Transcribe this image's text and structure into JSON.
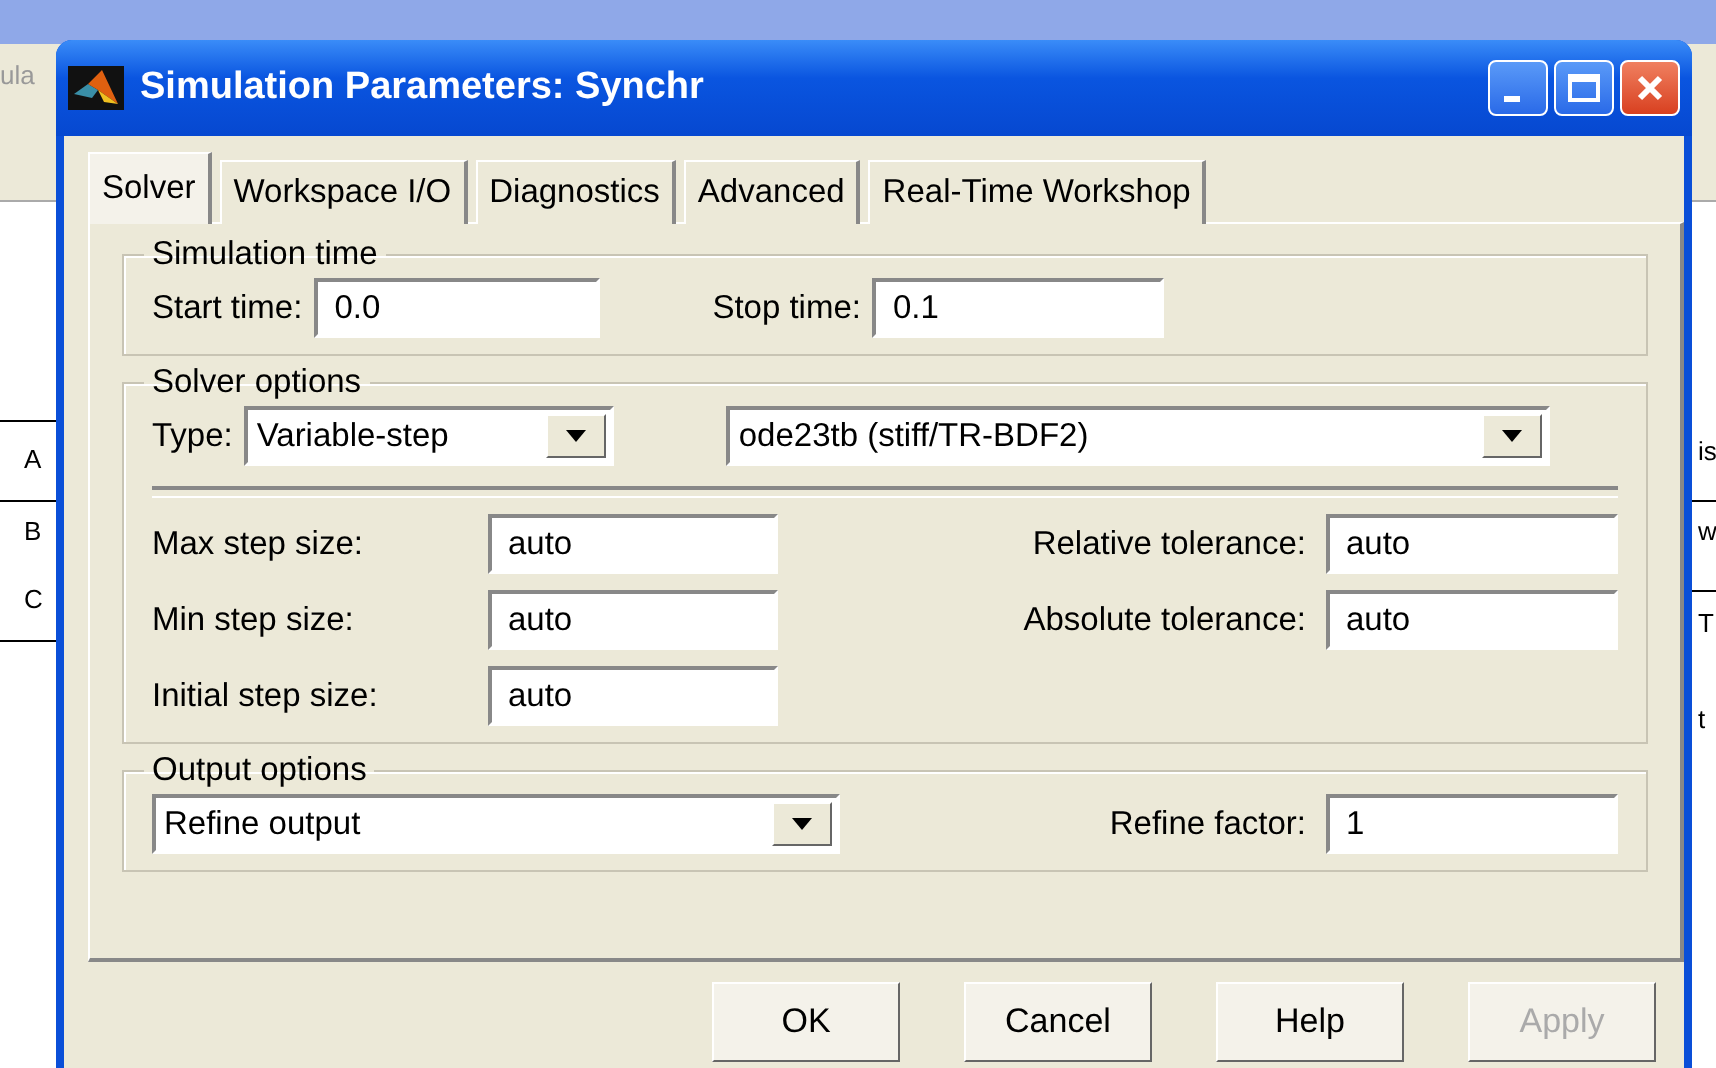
{
  "background_window": {
    "left_fragments": [
      "ula",
      "A",
      "B",
      "C"
    ],
    "right_fragments": [
      "is",
      "w",
      "T",
      "t"
    ]
  },
  "window": {
    "title": "Simulation Parameters: Synchr"
  },
  "tabs": [
    {
      "label": "Solver",
      "selected": true
    },
    {
      "label": "Workspace I/O",
      "selected": false
    },
    {
      "label": "Diagnostics",
      "selected": false
    },
    {
      "label": "Advanced",
      "selected": false
    },
    {
      "label": "Real-Time Workshop",
      "selected": false
    }
  ],
  "simulation_time": {
    "title": "Simulation time",
    "start_label": "Start time:",
    "start_value": "0.0",
    "stop_label": "Stop time:",
    "stop_value": "0.1"
  },
  "solver_options": {
    "title": "Solver options",
    "type_label": "Type:",
    "type_value": "Variable-step",
    "solver_value": "ode23tb (stiff/TR-BDF2)",
    "left_fields": [
      {
        "label": "Max step size:",
        "value": "auto"
      },
      {
        "label": "Min step size:",
        "value": "auto"
      },
      {
        "label": "Initial step size:",
        "value": "auto"
      }
    ],
    "right_fields": [
      {
        "label": "Relative tolerance:",
        "value": "auto"
      },
      {
        "label": "Absolute tolerance:",
        "value": "auto"
      }
    ]
  },
  "output_options": {
    "title": "Output options",
    "mode_value": "Refine output",
    "factor_label": "Refine factor:",
    "factor_value": "1"
  },
  "buttons": [
    {
      "label": "OK",
      "disabled": false
    },
    {
      "label": "Cancel",
      "disabled": false
    },
    {
      "label": "Help",
      "disabled": false
    },
    {
      "label": "Apply",
      "disabled": true
    }
  ]
}
